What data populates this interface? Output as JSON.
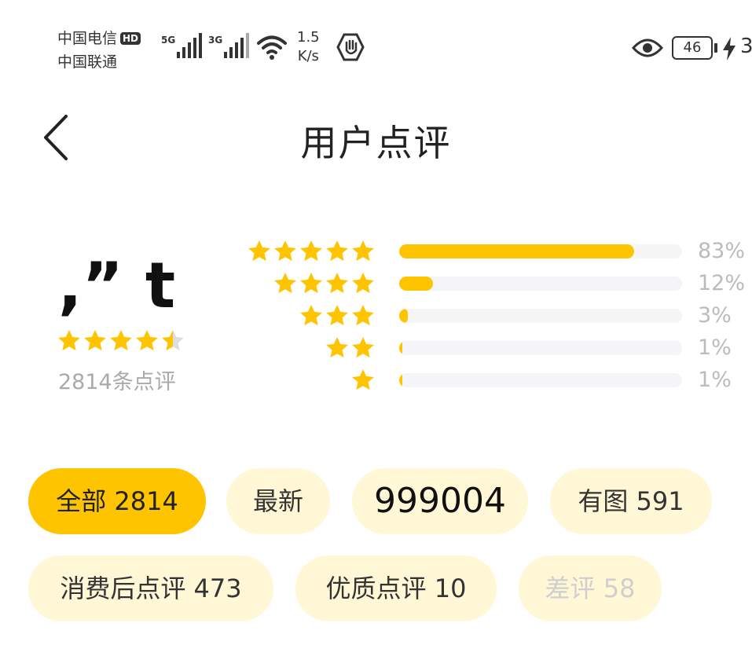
{
  "status_bar": {
    "carrier1": "中国电信",
    "hd_badge": "HD",
    "carrier2": "中国联通",
    "signal1_gen": "5G",
    "signal2_gen": "3G",
    "net_speed_value": "1.5",
    "net_speed_unit": "K/s",
    "battery_level": "46",
    "battery_cut_text": "3"
  },
  "header": {
    "title": "用户点评"
  },
  "summary": {
    "score": ",” t",
    "stars": 4.5,
    "review_count": "2814条点评"
  },
  "distribution": [
    {
      "stars": 5,
      "percent_text": "83%",
      "fraction": 0.83
    },
    {
      "stars": 4,
      "percent_text": "12%",
      "fraction": 0.12
    },
    {
      "stars": 3,
      "percent_text": "3%",
      "fraction": 0.03
    },
    {
      "stars": 2,
      "percent_text": "1%",
      "fraction": 0.01
    },
    {
      "stars": 1,
      "percent_text": "1%",
      "fraction": 0.01
    }
  ],
  "filters": [
    {
      "label": "全部 2814",
      "state": "active"
    },
    {
      "label": "最新",
      "state": "normal"
    },
    {
      "label": "999004",
      "state": "normal"
    },
    {
      "label": "有图 591",
      "state": "normal"
    },
    {
      "label": "消费后点评 473",
      "state": "normal"
    },
    {
      "label": "优质点评 10",
      "state": "normal"
    },
    {
      "label": "差评 58",
      "state": "disabled"
    }
  ],
  "colors": {
    "accent": "#ffc400",
    "chip_bg": "#fff7d6",
    "track": "#f5f5f7",
    "muted_text": "#aaaaaa"
  },
  "icons": {
    "back": "chevron-left-icon",
    "star": "star-icon",
    "wifi": "wifi-icon",
    "eye": "eye-icon",
    "hand": "hand-icon",
    "bolt": "lightning-bolt-icon"
  }
}
